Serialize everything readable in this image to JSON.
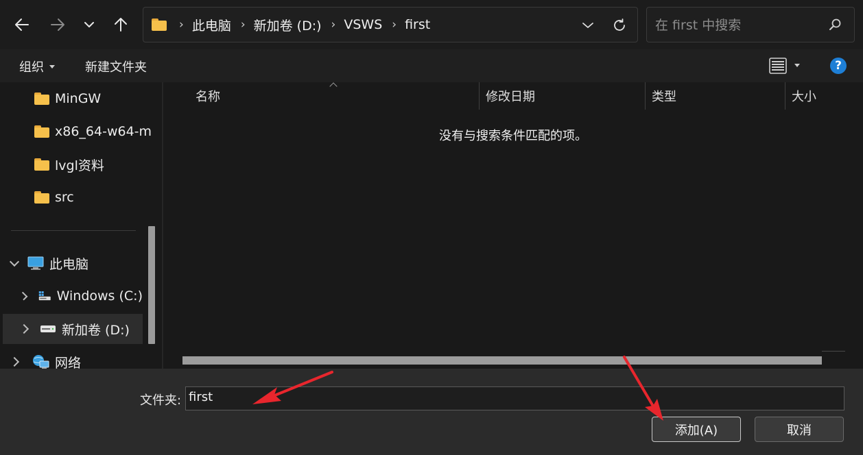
{
  "nav": {
    "back_icon": "arrow-left-icon",
    "forward_icon": "arrow-right-icon",
    "recent_icon": "chevron-down-icon",
    "up_icon": "arrow-up-icon"
  },
  "address": {
    "crumbs": [
      "此电脑",
      "新加卷 (D:)",
      "VSWS",
      "first"
    ],
    "separator": "›"
  },
  "search": {
    "placeholder": "在 first 中搜索"
  },
  "commandbar": {
    "organize_label": "组织",
    "new_folder_label": "新建文件夹",
    "help_label": "?"
  },
  "sidebar": {
    "folders": [
      {
        "label": "MinGW"
      },
      {
        "label": "x86_64-w64-m"
      },
      {
        "label": "lvgl资料"
      },
      {
        "label": "src"
      }
    ],
    "this_pc": "此电脑",
    "drives": [
      {
        "label": "Windows (C:)"
      },
      {
        "label": "新加卷 (D:)",
        "selected": true
      }
    ],
    "network": "网络"
  },
  "columns": {
    "name": "名称",
    "modified": "修改日期",
    "type": "类型",
    "size": "大小"
  },
  "main": {
    "empty_message": "没有与搜索条件匹配的项。"
  },
  "footer": {
    "folder_label": "文件夹:",
    "folder_value": "first",
    "add_button": "添加(A)",
    "cancel_button": "取消"
  },
  "colors": {
    "annotation_arrow": "#e8262d",
    "folder": "#f6c04b",
    "help": "#1e7fd6"
  }
}
